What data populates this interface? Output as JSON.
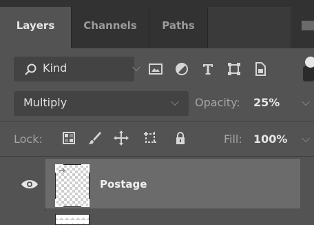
{
  "tabs": [
    {
      "label": "Layers",
      "active": true
    },
    {
      "label": "Channels",
      "active": false
    },
    {
      "label": "Paths",
      "active": false
    }
  ],
  "filter": {
    "label": "Kind",
    "icons": [
      "search-icon",
      "image-filter-icon",
      "adjustment-filter-icon",
      "type-filter-icon",
      "shape-filter-icon",
      "smart-object-filter-icon"
    ],
    "toggle_on": true
  },
  "blend": {
    "mode": "Multiply",
    "opacity_label": "Opacity:",
    "opacity_value": "25%"
  },
  "lock": {
    "label": "Lock:",
    "icons": [
      "lock-transparent-pixels-icon",
      "lock-image-pixels-icon",
      "lock-position-icon",
      "lock-artboard-icon",
      "lock-all-icon"
    ],
    "fill_label": "Fill:",
    "fill_value": "100%"
  },
  "layers": [
    {
      "name": "Postage",
      "visible": true,
      "selected": true
    }
  ],
  "colors": {
    "panel_bg": "#535353",
    "tab_bar_bg": "#323232",
    "selected_layer_bg": "#6b6b6b",
    "field_bg": "#434343"
  }
}
